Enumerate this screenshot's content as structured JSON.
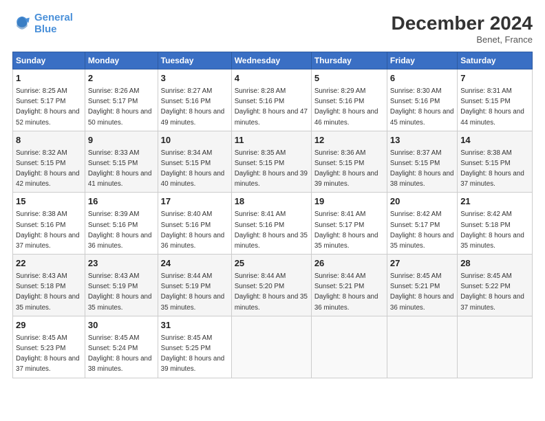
{
  "header": {
    "logo_line1": "General",
    "logo_line2": "Blue",
    "title": "December 2024",
    "subtitle": "Benet, France"
  },
  "days_of_week": [
    "Sunday",
    "Monday",
    "Tuesday",
    "Wednesday",
    "Thursday",
    "Friday",
    "Saturday"
  ],
  "weeks": [
    [
      {
        "day": "1",
        "sunrise": "8:25 AM",
        "sunset": "5:17 PM",
        "daylight": "8 hours and 52 minutes."
      },
      {
        "day": "2",
        "sunrise": "8:26 AM",
        "sunset": "5:17 PM",
        "daylight": "8 hours and 50 minutes."
      },
      {
        "day": "3",
        "sunrise": "8:27 AM",
        "sunset": "5:16 PM",
        "daylight": "8 hours and 49 minutes."
      },
      {
        "day": "4",
        "sunrise": "8:28 AM",
        "sunset": "5:16 PM",
        "daylight": "8 hours and 47 minutes."
      },
      {
        "day": "5",
        "sunrise": "8:29 AM",
        "sunset": "5:16 PM",
        "daylight": "8 hours and 46 minutes."
      },
      {
        "day": "6",
        "sunrise": "8:30 AM",
        "sunset": "5:16 PM",
        "daylight": "8 hours and 45 minutes."
      },
      {
        "day": "7",
        "sunrise": "8:31 AM",
        "sunset": "5:15 PM",
        "daylight": "8 hours and 44 minutes."
      }
    ],
    [
      {
        "day": "8",
        "sunrise": "8:32 AM",
        "sunset": "5:15 PM",
        "daylight": "8 hours and 42 minutes."
      },
      {
        "day": "9",
        "sunrise": "8:33 AM",
        "sunset": "5:15 PM",
        "daylight": "8 hours and 41 minutes."
      },
      {
        "day": "10",
        "sunrise": "8:34 AM",
        "sunset": "5:15 PM",
        "daylight": "8 hours and 40 minutes."
      },
      {
        "day": "11",
        "sunrise": "8:35 AM",
        "sunset": "5:15 PM",
        "daylight": "8 hours and 39 minutes."
      },
      {
        "day": "12",
        "sunrise": "8:36 AM",
        "sunset": "5:15 PM",
        "daylight": "8 hours and 39 minutes."
      },
      {
        "day": "13",
        "sunrise": "8:37 AM",
        "sunset": "5:15 PM",
        "daylight": "8 hours and 38 minutes."
      },
      {
        "day": "14",
        "sunrise": "8:38 AM",
        "sunset": "5:15 PM",
        "daylight": "8 hours and 37 minutes."
      }
    ],
    [
      {
        "day": "15",
        "sunrise": "8:38 AM",
        "sunset": "5:16 PM",
        "daylight": "8 hours and 37 minutes."
      },
      {
        "day": "16",
        "sunrise": "8:39 AM",
        "sunset": "5:16 PM",
        "daylight": "8 hours and 36 minutes."
      },
      {
        "day": "17",
        "sunrise": "8:40 AM",
        "sunset": "5:16 PM",
        "daylight": "8 hours and 36 minutes."
      },
      {
        "day": "18",
        "sunrise": "8:41 AM",
        "sunset": "5:16 PM",
        "daylight": "8 hours and 35 minutes."
      },
      {
        "day": "19",
        "sunrise": "8:41 AM",
        "sunset": "5:17 PM",
        "daylight": "8 hours and 35 minutes."
      },
      {
        "day": "20",
        "sunrise": "8:42 AM",
        "sunset": "5:17 PM",
        "daylight": "8 hours and 35 minutes."
      },
      {
        "day": "21",
        "sunrise": "8:42 AM",
        "sunset": "5:18 PM",
        "daylight": "8 hours and 35 minutes."
      }
    ],
    [
      {
        "day": "22",
        "sunrise": "8:43 AM",
        "sunset": "5:18 PM",
        "daylight": "8 hours and 35 minutes."
      },
      {
        "day": "23",
        "sunrise": "8:43 AM",
        "sunset": "5:19 PM",
        "daylight": "8 hours and 35 minutes."
      },
      {
        "day": "24",
        "sunrise": "8:44 AM",
        "sunset": "5:19 PM",
        "daylight": "8 hours and 35 minutes."
      },
      {
        "day": "25",
        "sunrise": "8:44 AM",
        "sunset": "5:20 PM",
        "daylight": "8 hours and 35 minutes."
      },
      {
        "day": "26",
        "sunrise": "8:44 AM",
        "sunset": "5:21 PM",
        "daylight": "8 hours and 36 minutes."
      },
      {
        "day": "27",
        "sunrise": "8:45 AM",
        "sunset": "5:21 PM",
        "daylight": "8 hours and 36 minutes."
      },
      {
        "day": "28",
        "sunrise": "8:45 AM",
        "sunset": "5:22 PM",
        "daylight": "8 hours and 37 minutes."
      }
    ],
    [
      {
        "day": "29",
        "sunrise": "8:45 AM",
        "sunset": "5:23 PM",
        "daylight": "8 hours and 37 minutes."
      },
      {
        "day": "30",
        "sunrise": "8:45 AM",
        "sunset": "5:24 PM",
        "daylight": "8 hours and 38 minutes."
      },
      {
        "day": "31",
        "sunrise": "8:45 AM",
        "sunset": "5:25 PM",
        "daylight": "8 hours and 39 minutes."
      },
      null,
      null,
      null,
      null
    ]
  ],
  "labels": {
    "sunrise": "Sunrise:",
    "sunset": "Sunset:",
    "daylight": "Daylight:"
  }
}
